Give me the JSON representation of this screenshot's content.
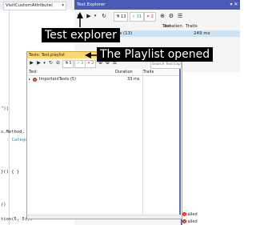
{
  "editor": {
    "tab_label": "VisitCustomAttribute(",
    "lines": [
      {
        "text": "\")]",
        "color": "#a31515"
      },
      {
        "text": "s.Method, A",
        "color": "#1e1e1e"
      },
      {
        "text": ": Category",
        "color": "#2b91af"
      },
      {
        "text": "}() { }",
        "color": "#1e1e1e"
      },
      {
        "text": "()",
        "color": "#1e1e1e"
      },
      {
        "text": "tion(5, 5));",
        "color": "#1e1e1e"
      }
    ]
  },
  "test_explorer": {
    "title": "Test Explorer",
    "badges": {
      "total": "13",
      "passed": "11",
      "failed": "2"
    },
    "columns": {
      "test": "Test",
      "duration": "Duration",
      "traits": "Traits"
    },
    "row": {
      "name": "ests (13)",
      "duration": "249 ms"
    },
    "bottom_items": [
      "ailed",
      "ailed"
    ]
  },
  "playlist": {
    "title": "Tests: Test.playlist",
    "badges": {
      "total": "5",
      "passed": "3",
      "failed": "2"
    },
    "search_placeholder": "Search Test Explorer",
    "columns": {
      "test": "Test",
      "duration": "Duration",
      "traits": "Traits"
    },
    "rows": [
      {
        "name": "ImportantTests (5)",
        "duration": "33 ms"
      }
    ]
  },
  "callouts": {
    "test_explorer": "Test explorer",
    "playlist": "The Playlist opened"
  },
  "colors": {
    "accent": "#4a5bb5",
    "playlist_title": "#f7d978",
    "failed": "#e51400",
    "passed": "#16a34a"
  }
}
